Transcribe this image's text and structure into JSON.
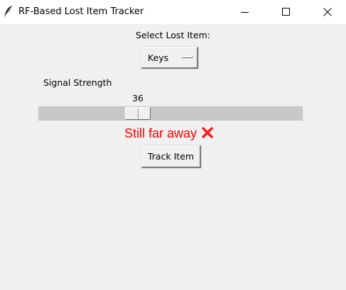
{
  "window": {
    "title": "RF-Based Lost Item Tracker"
  },
  "select": {
    "label": "Select Lost Item:",
    "selected": "Keys"
  },
  "signal": {
    "label": "Signal Strength",
    "value": 36,
    "value_text": "36",
    "min": 0,
    "max": 100
  },
  "status": {
    "text": "Still far away",
    "icon": "cross-mark-icon",
    "color": "#ff0000"
  },
  "actions": {
    "track_label": "Track Item"
  }
}
